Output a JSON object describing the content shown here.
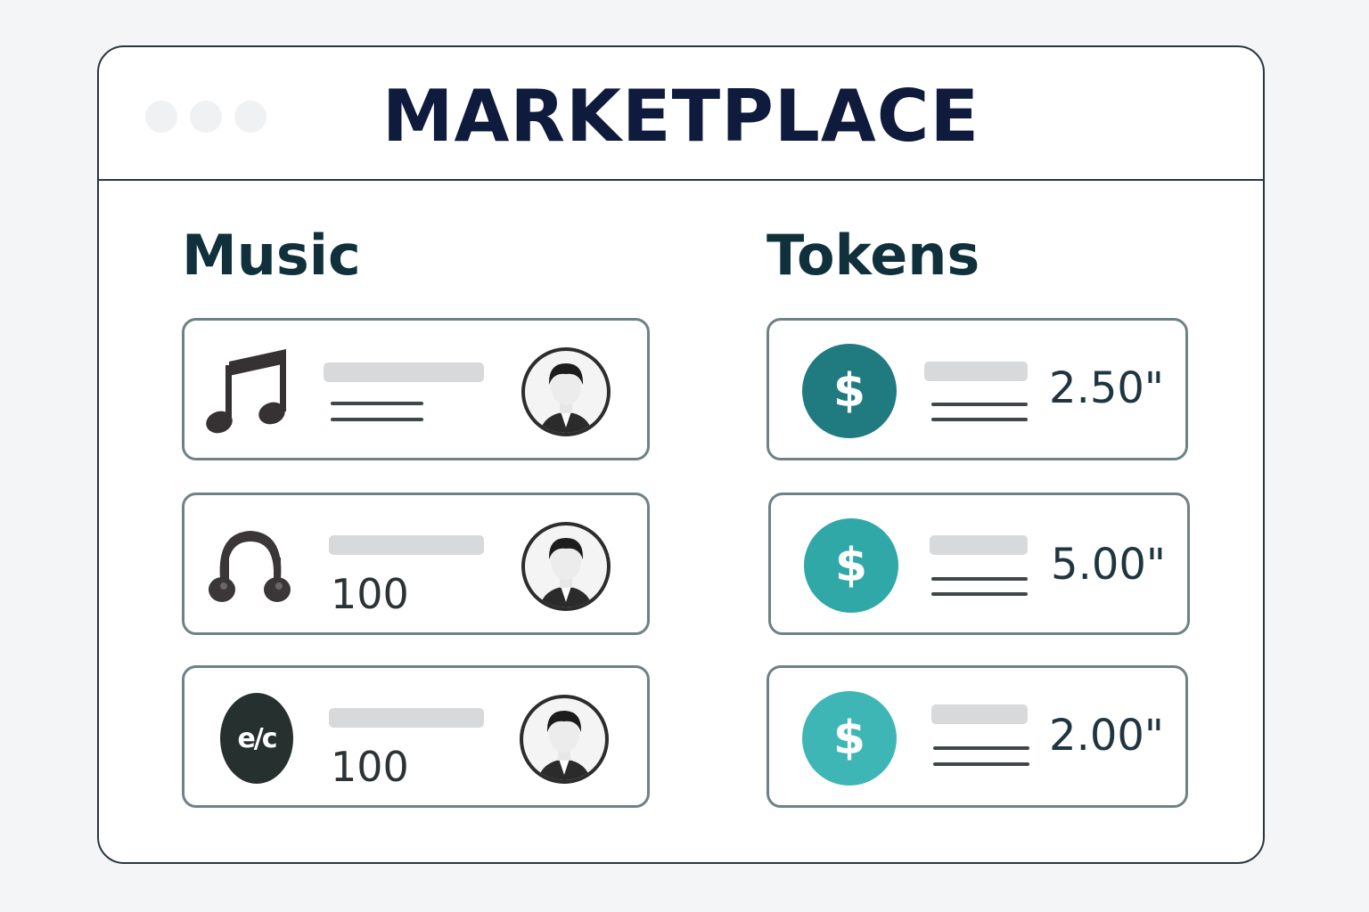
{
  "app": {
    "title": "MARKETPLACE"
  },
  "sections": {
    "music": {
      "heading": "Music",
      "items": [
        {
          "icon": "music-note-icon",
          "count": ""
        },
        {
          "icon": "beamed-notes-icon",
          "count": "100"
        },
        {
          "icon": "logo-badge-icon",
          "count": "100"
        }
      ]
    },
    "tokens": {
      "heading": "Tokens",
      "items": [
        {
          "icon": "dollar-coin-icon",
          "price": "2.50\"",
          "color": "#1f7b80"
        },
        {
          "icon": "dollar-coin-icon",
          "price": "5.00\"",
          "color": "#30a8a8"
        },
        {
          "icon": "dollar-coin-icon",
          "price": "2.00\"",
          "color": "#3fb6b6"
        }
      ]
    }
  }
}
